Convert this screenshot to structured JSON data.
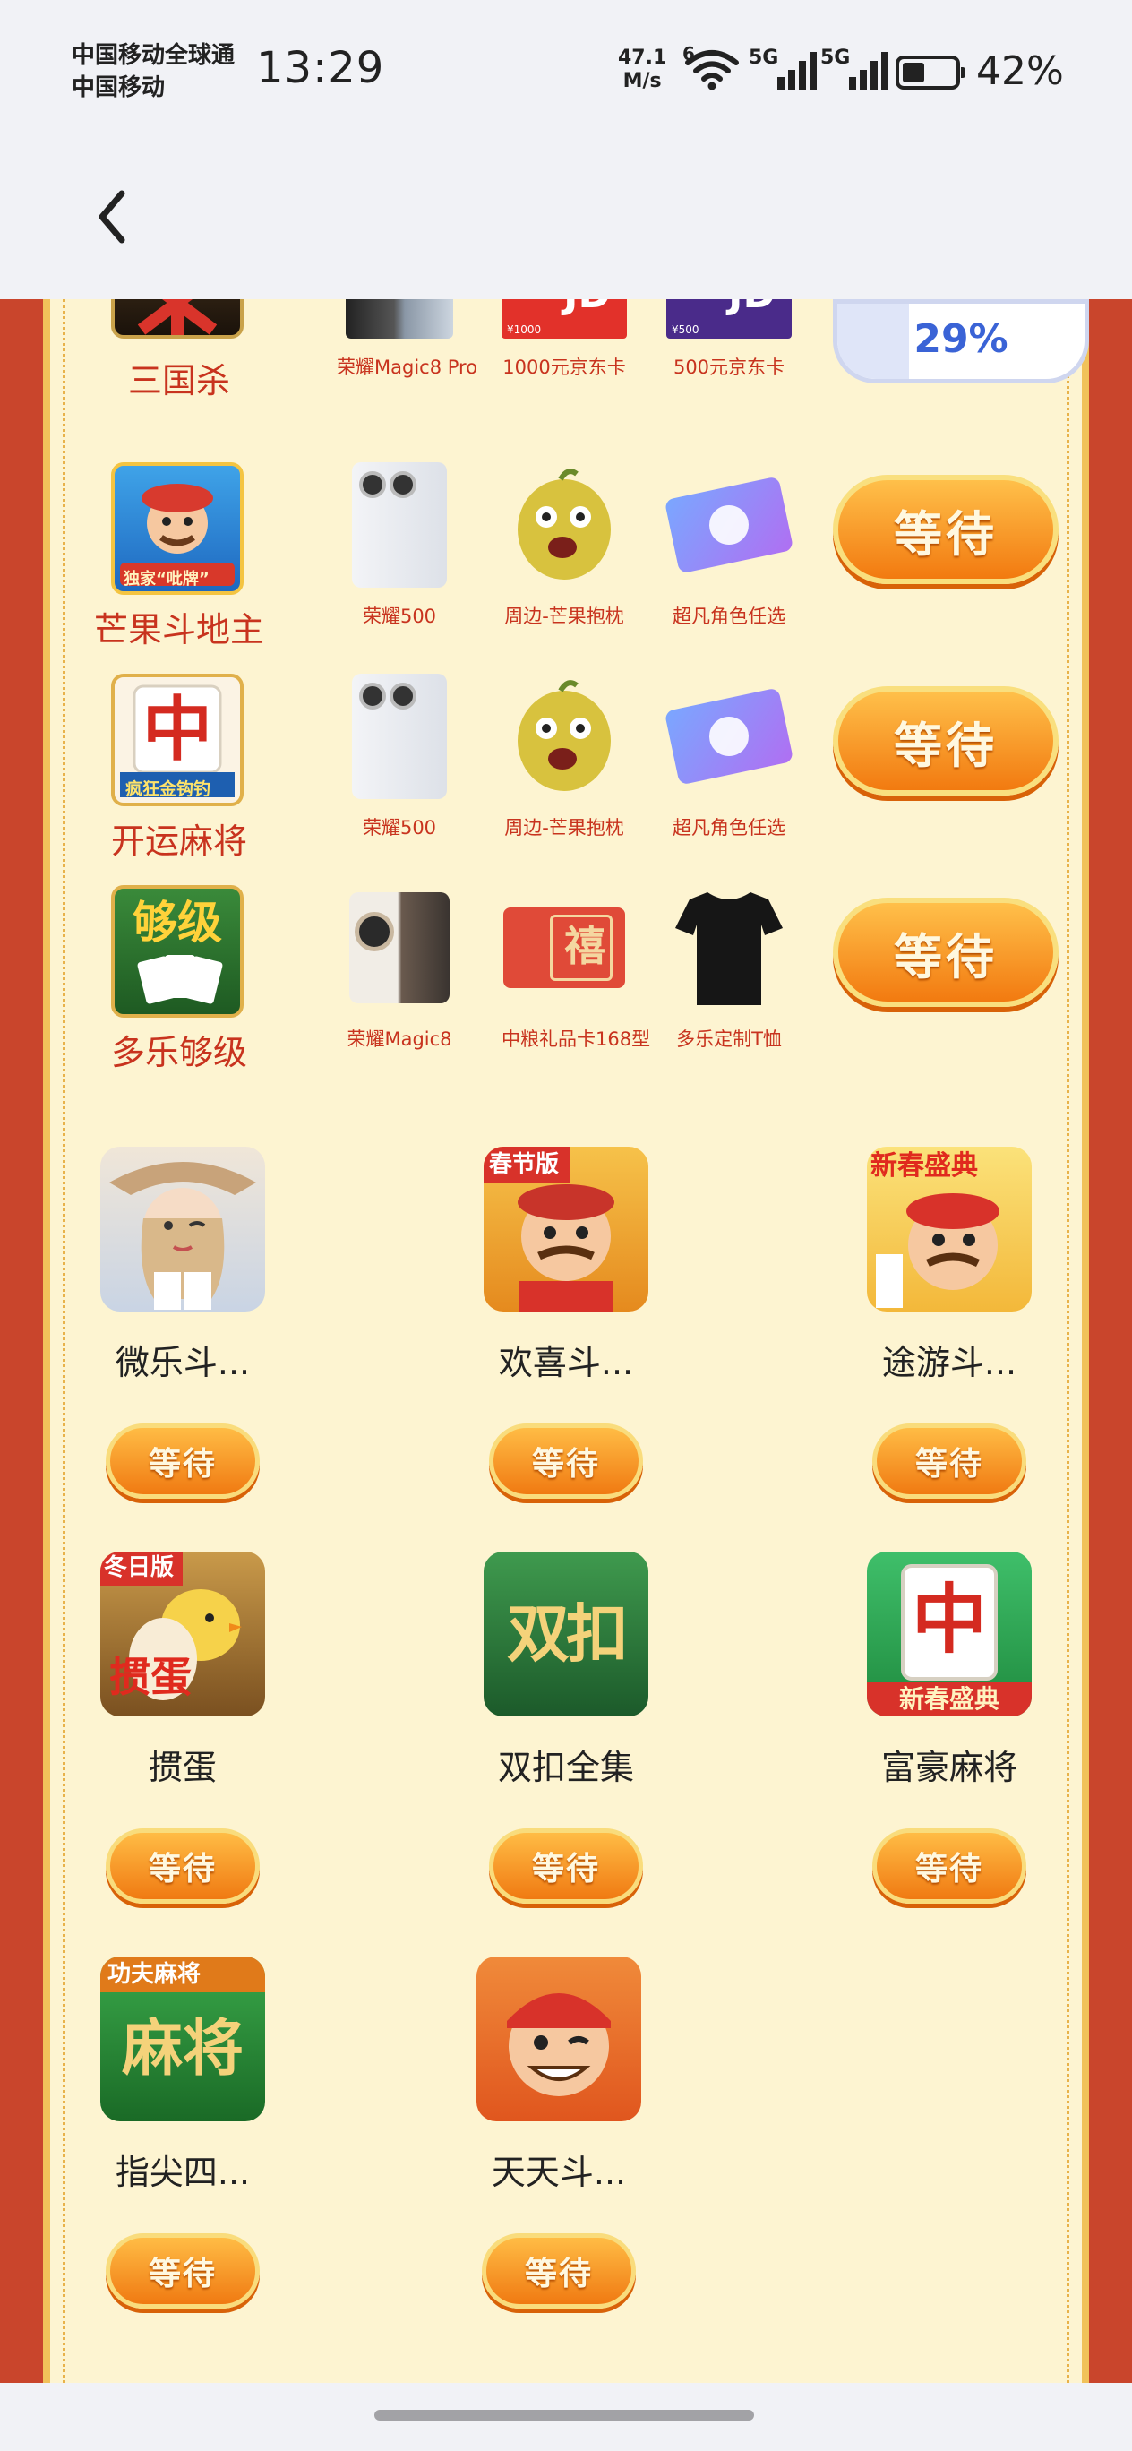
{
  "status_bar": {
    "carrier_1": "中国移动全球通",
    "carrier_2": "中国移动",
    "time": "13:29",
    "net_speed_value": "47.1",
    "net_speed_unit": "M/s",
    "wifi_badge": "6",
    "sim1_label": "5G",
    "sim2_label": "5G",
    "battery_percent": "42%",
    "battery_level": 0.42
  },
  "nav": {
    "back_icon": "chevron-left-icon"
  },
  "progress": {
    "text": "29%",
    "value": 0.29
  },
  "prize_rows": [
    {
      "game": "三国杀",
      "prizes": [
        "荣耀Magic8 Pro",
        "1000元京东卡",
        "500元京东卡"
      ],
      "button": null
    },
    {
      "game": "芒果斗地主",
      "prizes": [
        "荣耀500",
        "周边-芒果抱枕",
        "超凡角色任选"
      ],
      "button": "等待"
    },
    {
      "game": "开运麻将",
      "prizes": [
        "荣耀500",
        "周边-芒果抱枕",
        "超凡角色任选"
      ],
      "button": "等待"
    },
    {
      "game": "多乐够级",
      "prizes": [
        "荣耀Magic8",
        "中粮礼品卡168型",
        "多乐定制T恤"
      ],
      "button": "等待"
    }
  ],
  "grid_games": [
    {
      "name": "微乐斗...",
      "button": "等待"
    },
    {
      "name": "欢喜斗...",
      "button": "等待"
    },
    {
      "name": "途游斗...",
      "button": "等待"
    },
    {
      "name": "掼蛋",
      "button": "等待"
    },
    {
      "name": "双扣全集",
      "button": "等待"
    },
    {
      "name": "富豪麻将",
      "button": "等待"
    },
    {
      "name": "指尖四...",
      "button": "等待"
    },
    {
      "name": "天天斗...",
      "button": "等待"
    }
  ],
  "art_text": {
    "jd": "JD",
    "jd_1000": "¥1000",
    "jd_500": "¥500",
    "doudizhu_badge": "独家“吡牌”",
    "zhong": "中",
    "majiang_badge": "疯狂金钩钓",
    "gouji": "够级",
    "xi": "禧",
    "chunjie_badge": "春节版",
    "xinchun_badge": "新春盛典",
    "dongri_badge": "冬日版",
    "guandan": "掼蛋",
    "shuangkou": "双扣",
    "fuhao_badge": "新春盛典",
    "gongfu_badge": "功夫麻将",
    "majiang": "麻将"
  }
}
